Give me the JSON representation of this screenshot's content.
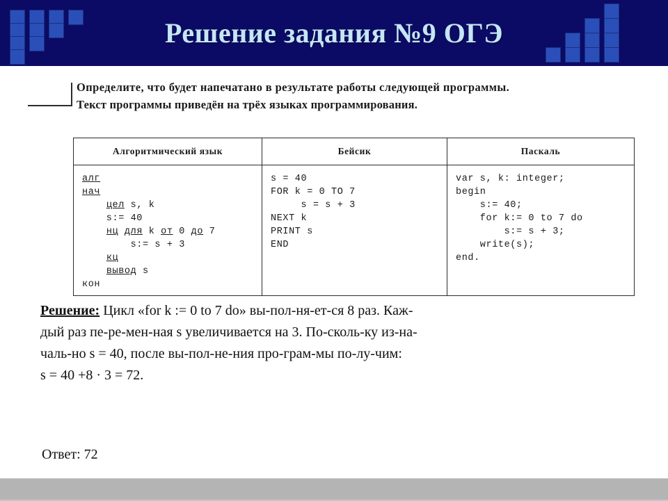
{
  "slide": {
    "title": "Решение задания №9 ОГЭ",
    "title_color": "#c5e6f5",
    "banner_color": "#0b0b66",
    "deco_square_color": "#2b4fb8",
    "footer_color": "#b4b4b4"
  },
  "question": {
    "line1": "Определите, что будет напечатано в результате работы следующей программы.",
    "line2": "Текст программы приведён на трёх языках программирования."
  },
  "table": {
    "headers": [
      "Алгоритмический язык",
      "Бейсик",
      "Паскаль"
    ],
    "cells": {
      "algorithmic": "алг\nнач\n    цел s, k\n    s:= 40\n    нц для k от 0 до 7\n        s:= s + 3\n    кц\n    вывод s\nкон",
      "basic": "s = 40\nFOR k = 0 TO 7\n     s = s + 3\nNEXT k\nPRINT s\nEND",
      "pascal": "var s, k: integer;\nbegin\n    s:= 40;\n    for k:= 0 to 7 do\n        s:= s + 3;\n    write(s);\nend."
    }
  },
  "solution": {
    "label": "Решение:",
    "line1": " Цикл «for k := 0 to 7 do» вы-пол-ня-ет-ся 8 раз. Каж-",
    "line2": "дый раз пе-ре-мен-ная s увеличивается на 3. По-сколь-ку из-на-",
    "line3": "чаль-но s = 40, после вы-пол-не-ния про-грам-мы по-лу-чим:",
    "line4": "s = 40 +8 · 3 = 72."
  },
  "answer": {
    "text": "Ответ: 72"
  }
}
